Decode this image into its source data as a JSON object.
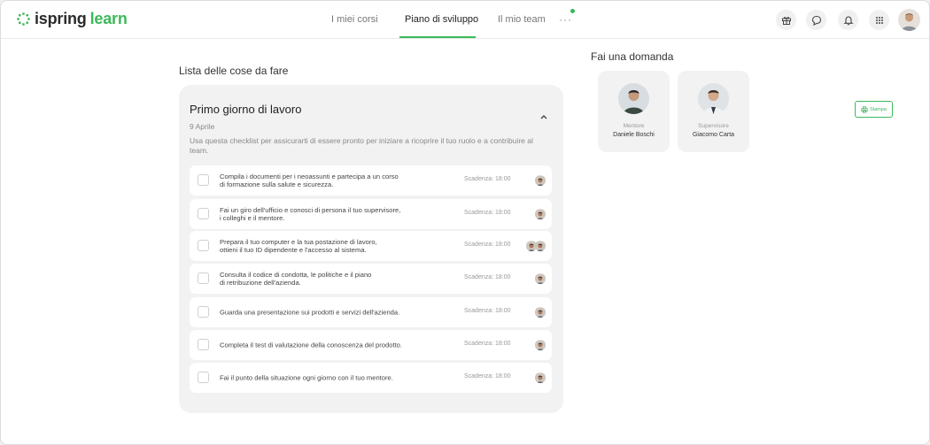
{
  "header": {
    "logo_text_a": "ispring",
    "logo_text_b": "learn",
    "nav": [
      {
        "label": "I miei corsi",
        "active": false
      },
      {
        "label": "Piano di sviluppo",
        "active": true
      },
      {
        "label": "Il mio team",
        "active": false
      }
    ],
    "more_label": "···",
    "icons": [
      "gift-icon",
      "chat-icon",
      "bell-icon",
      "apps-grid-icon"
    ]
  },
  "todo": {
    "section_title": "Lista delle cose da fare",
    "card_title": "Primo giorno di lavoro",
    "date": "9 Aprile",
    "description": "Usa questa checklist per assicurarti di essere pronto per iniziare a ricoprire il tuo ruolo e a contribuire al team.",
    "tasks": [
      {
        "text": "Compila i documenti per i neoassunti e partecipa a un corso\ndi formazione sulla salute e sicurezza.",
        "deadline": "Scadenza: 18:00",
        "avatars": 1
      },
      {
        "text": "Fai un giro dell'ufficio e conosci di persona il tuo supervisore,\ni colleghi e il mentore.",
        "deadline": "Scadenza: 18:00",
        "avatars": 1
      },
      {
        "text": "Prepara il tuo computer e la tua postazione di lavoro,\nottieni il tuo ID dipendente e l'accesso al sistema.",
        "deadline": "Scadenza: 18:00",
        "avatars": 2
      },
      {
        "text": "Consulta il codice di condotta, le politiche e il piano\ndi retribuzione dell'azienda.",
        "deadline": "Scadenza: 18:00",
        "avatars": 1
      },
      {
        "text": "Guarda una presentazione sui prodotti e servizi dell'azienda.",
        "deadline": "Scadenza: 18:00",
        "avatars": 1
      },
      {
        "text": "Completa il test di valutazione della conoscenza del prodotto.",
        "deadline": "Scadenza: 18:00",
        "avatars": 1
      },
      {
        "text": "Fai il punto della situazione ogni giorno con il tuo mentore.",
        "deadline": "Scadenza: 18:00",
        "avatars": 1
      }
    ]
  },
  "ask": {
    "section_title": "Fai una domanda",
    "people": [
      {
        "role": "Mentore",
        "name": "Daniele Boschi"
      },
      {
        "role": "Supervisore",
        "name": "Giacomo Carta"
      }
    ],
    "print_label": "Stampa"
  },
  "colors": {
    "accent": "#3cb95a",
    "card": "#f2f2f2"
  }
}
